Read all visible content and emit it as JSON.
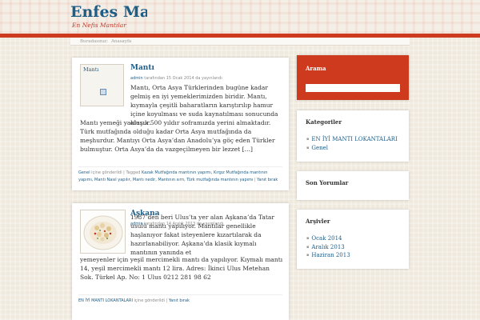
{
  "site": {
    "title": "Enfes Mantı",
    "description": "En Nefis Mantılar"
  },
  "breadcrumb": {
    "prefix": "Buradasınız:",
    "current": "Anasayfa"
  },
  "posts": [
    {
      "title": "Mantı",
      "thumb_label": "Mantı",
      "author": "admin",
      "meta_rest": " tarafından 15 Ocak 2014 da yayınlandı",
      "excerpt_top": "Mantı, Orta Asya Türklerinden bugüne kadar gelmiş en iyi yemeklerimizden biridir. Mantı, kıymayla çeşitli baharatların karıştırılıp hamur içine koyulması ve suda kaynatılması sonucunda oluşur.",
      "excerpt_bottom": "Mantı yemeği yaklaşık 500 yıldır soframızda yerini almaktadır. Türk mutfağında olduğu kadar Orta Asya mutfağında da meşhurdur. Mantıyı Orta Asya’dan Anadolu’ya göç eden Türkler bulmuştur. Orta Asya’da da vazgeçilmeyen bir lezzet […]",
      "footer_cat": "Genel",
      "footer_mid": " içine gönderildi | Tagged ",
      "footer_tags": "Kazak Mutfağında mantının yapımı, Kırgız Mutfağında mantının yapımı, Mantı Nasıl yapılır, Mantı nedir, Mantının sırrı, Türk mutfağında mantının yapımı",
      "footer_sep": " | ",
      "footer_reply": "Yanıt bırak"
    },
    {
      "title": "Aşkana",
      "author": "admin",
      "meta_rest": " tarafından 14 Aralık 2013 da yayınlandı",
      "excerpt_top": " 1987’den beri Ulus’ta yer alan Aşkana’da Tatar usulü mantı yapılıyor. Mantılar genellikle haşlanıyor fakat isteyenlere kızartılarak da hazırlanabiliyor. Aşkana’da klasik kıymalı mantının yanında et",
      "excerpt_bottom": "yemeyenler için yeşil mercimekli mantı da yapılıyor. Kıymalı mantı 14, yeşil mercimekli mantı 12 lira. Adres: İkinci Ulus Metehan Sok. Türkel Ap. No: 1 Ulus 0212 281 98 62",
      "footer_cat": "EN İYİ MANTI LOKANTALARI",
      "footer_mid": " içine gönderildi | ",
      "footer_reply": "Yanıt bırak"
    }
  ],
  "sidebar": {
    "search_title": "Arama",
    "categories_title": "Kategoriler",
    "categories": [
      "EN İYİ MANTI LOKANTALARI",
      "Genel"
    ],
    "recent_comments_title": "Son Yorumlar",
    "archives_title": "Arşivler",
    "archives": [
      "Ocak 2014",
      "Aralık 2013",
      "Haziran 2013"
    ]
  },
  "colors": {
    "accent": "#cd3a1e",
    "link": "#1d5d86"
  }
}
